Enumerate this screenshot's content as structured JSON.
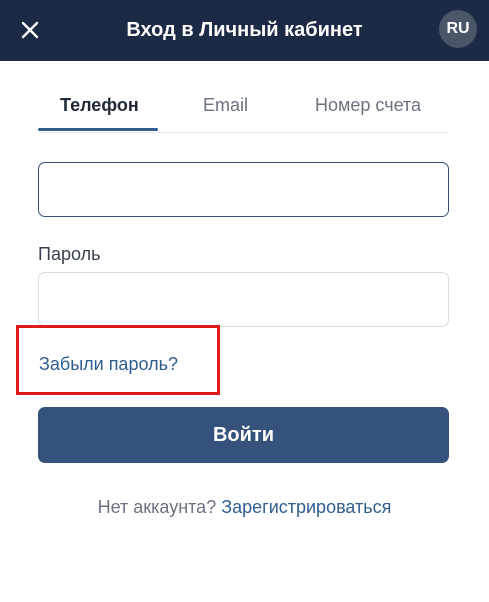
{
  "header": {
    "title": "Вход в Личный кабинет",
    "close_icon": "close-icon",
    "language": "RU"
  },
  "tabs": [
    {
      "label": "Телефон",
      "active": true
    },
    {
      "label": "Email",
      "active": false
    },
    {
      "label": "Номер счета",
      "active": false
    }
  ],
  "form": {
    "phone_value": "",
    "password_label": "Пароль",
    "password_value": "",
    "forgot_password": "Забыли пароль?",
    "login_button": "Войти"
  },
  "footer": {
    "no_account": "Нет аккаунта?",
    "register_link": "Зарегистрироваться"
  },
  "colors": {
    "header_bg": "#1c2a45",
    "accent": "#34527c",
    "link": "#2f5d8f",
    "highlight": "#e01b1b"
  }
}
